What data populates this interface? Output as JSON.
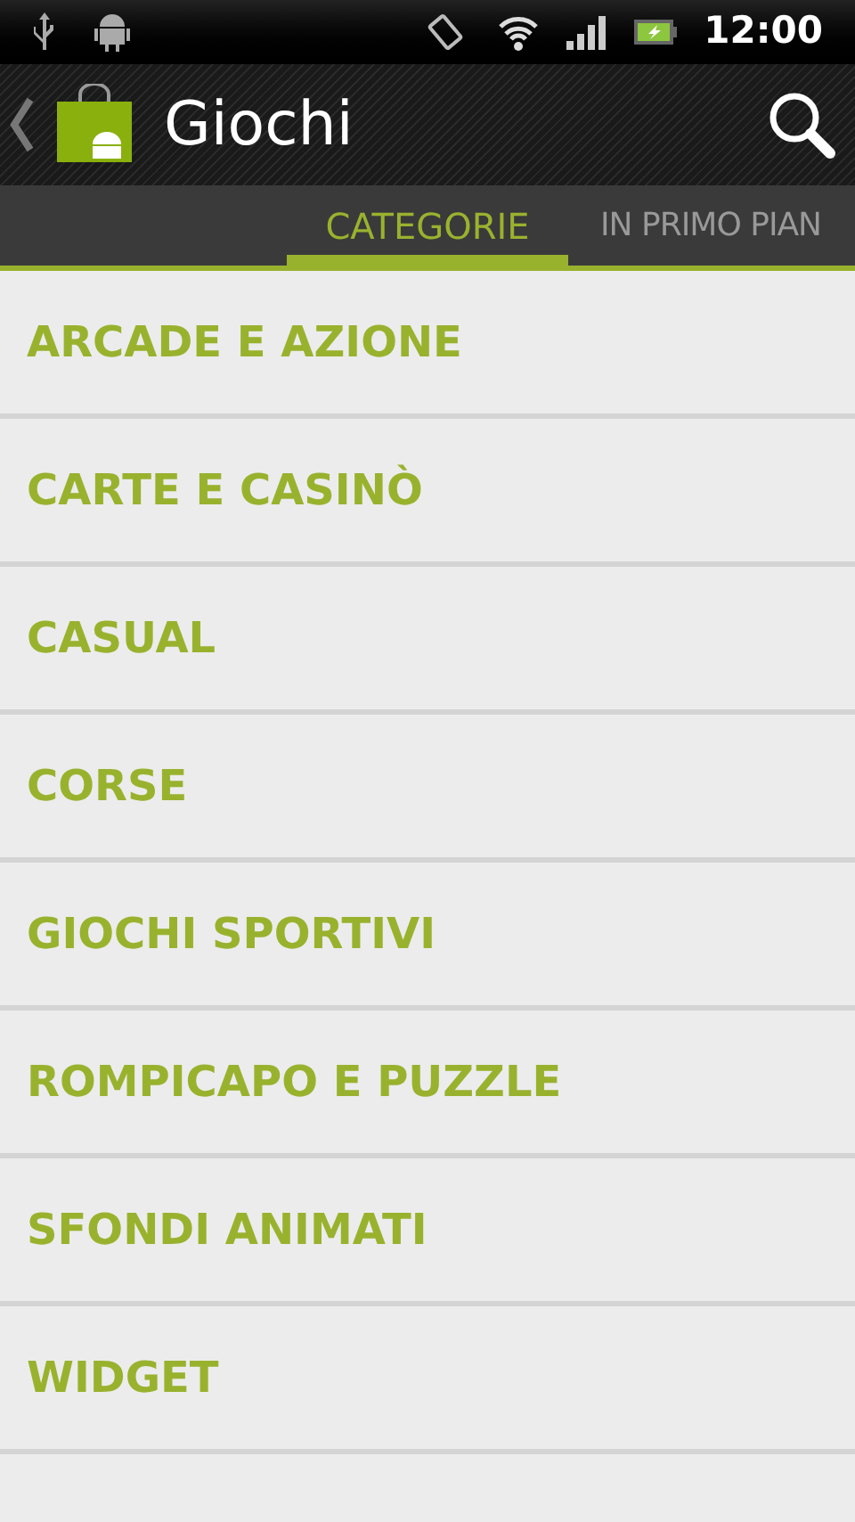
{
  "status_bar": {
    "time": "12:00"
  },
  "action_bar": {
    "title": "Giochi"
  },
  "tabs": [
    {
      "label": "CATEGORIE",
      "selected": true
    },
    {
      "label": "IN PRIMO PIAN",
      "selected": false
    }
  ],
  "categories": [
    "ARCADE E AZIONE",
    "CARTE E CASINÒ",
    "CASUAL",
    "CORSE",
    "GIOCHI SPORTIVI",
    "ROMPICAPO E PUZZLE",
    "SFONDI ANIMATI",
    "WIDGET"
  ]
}
